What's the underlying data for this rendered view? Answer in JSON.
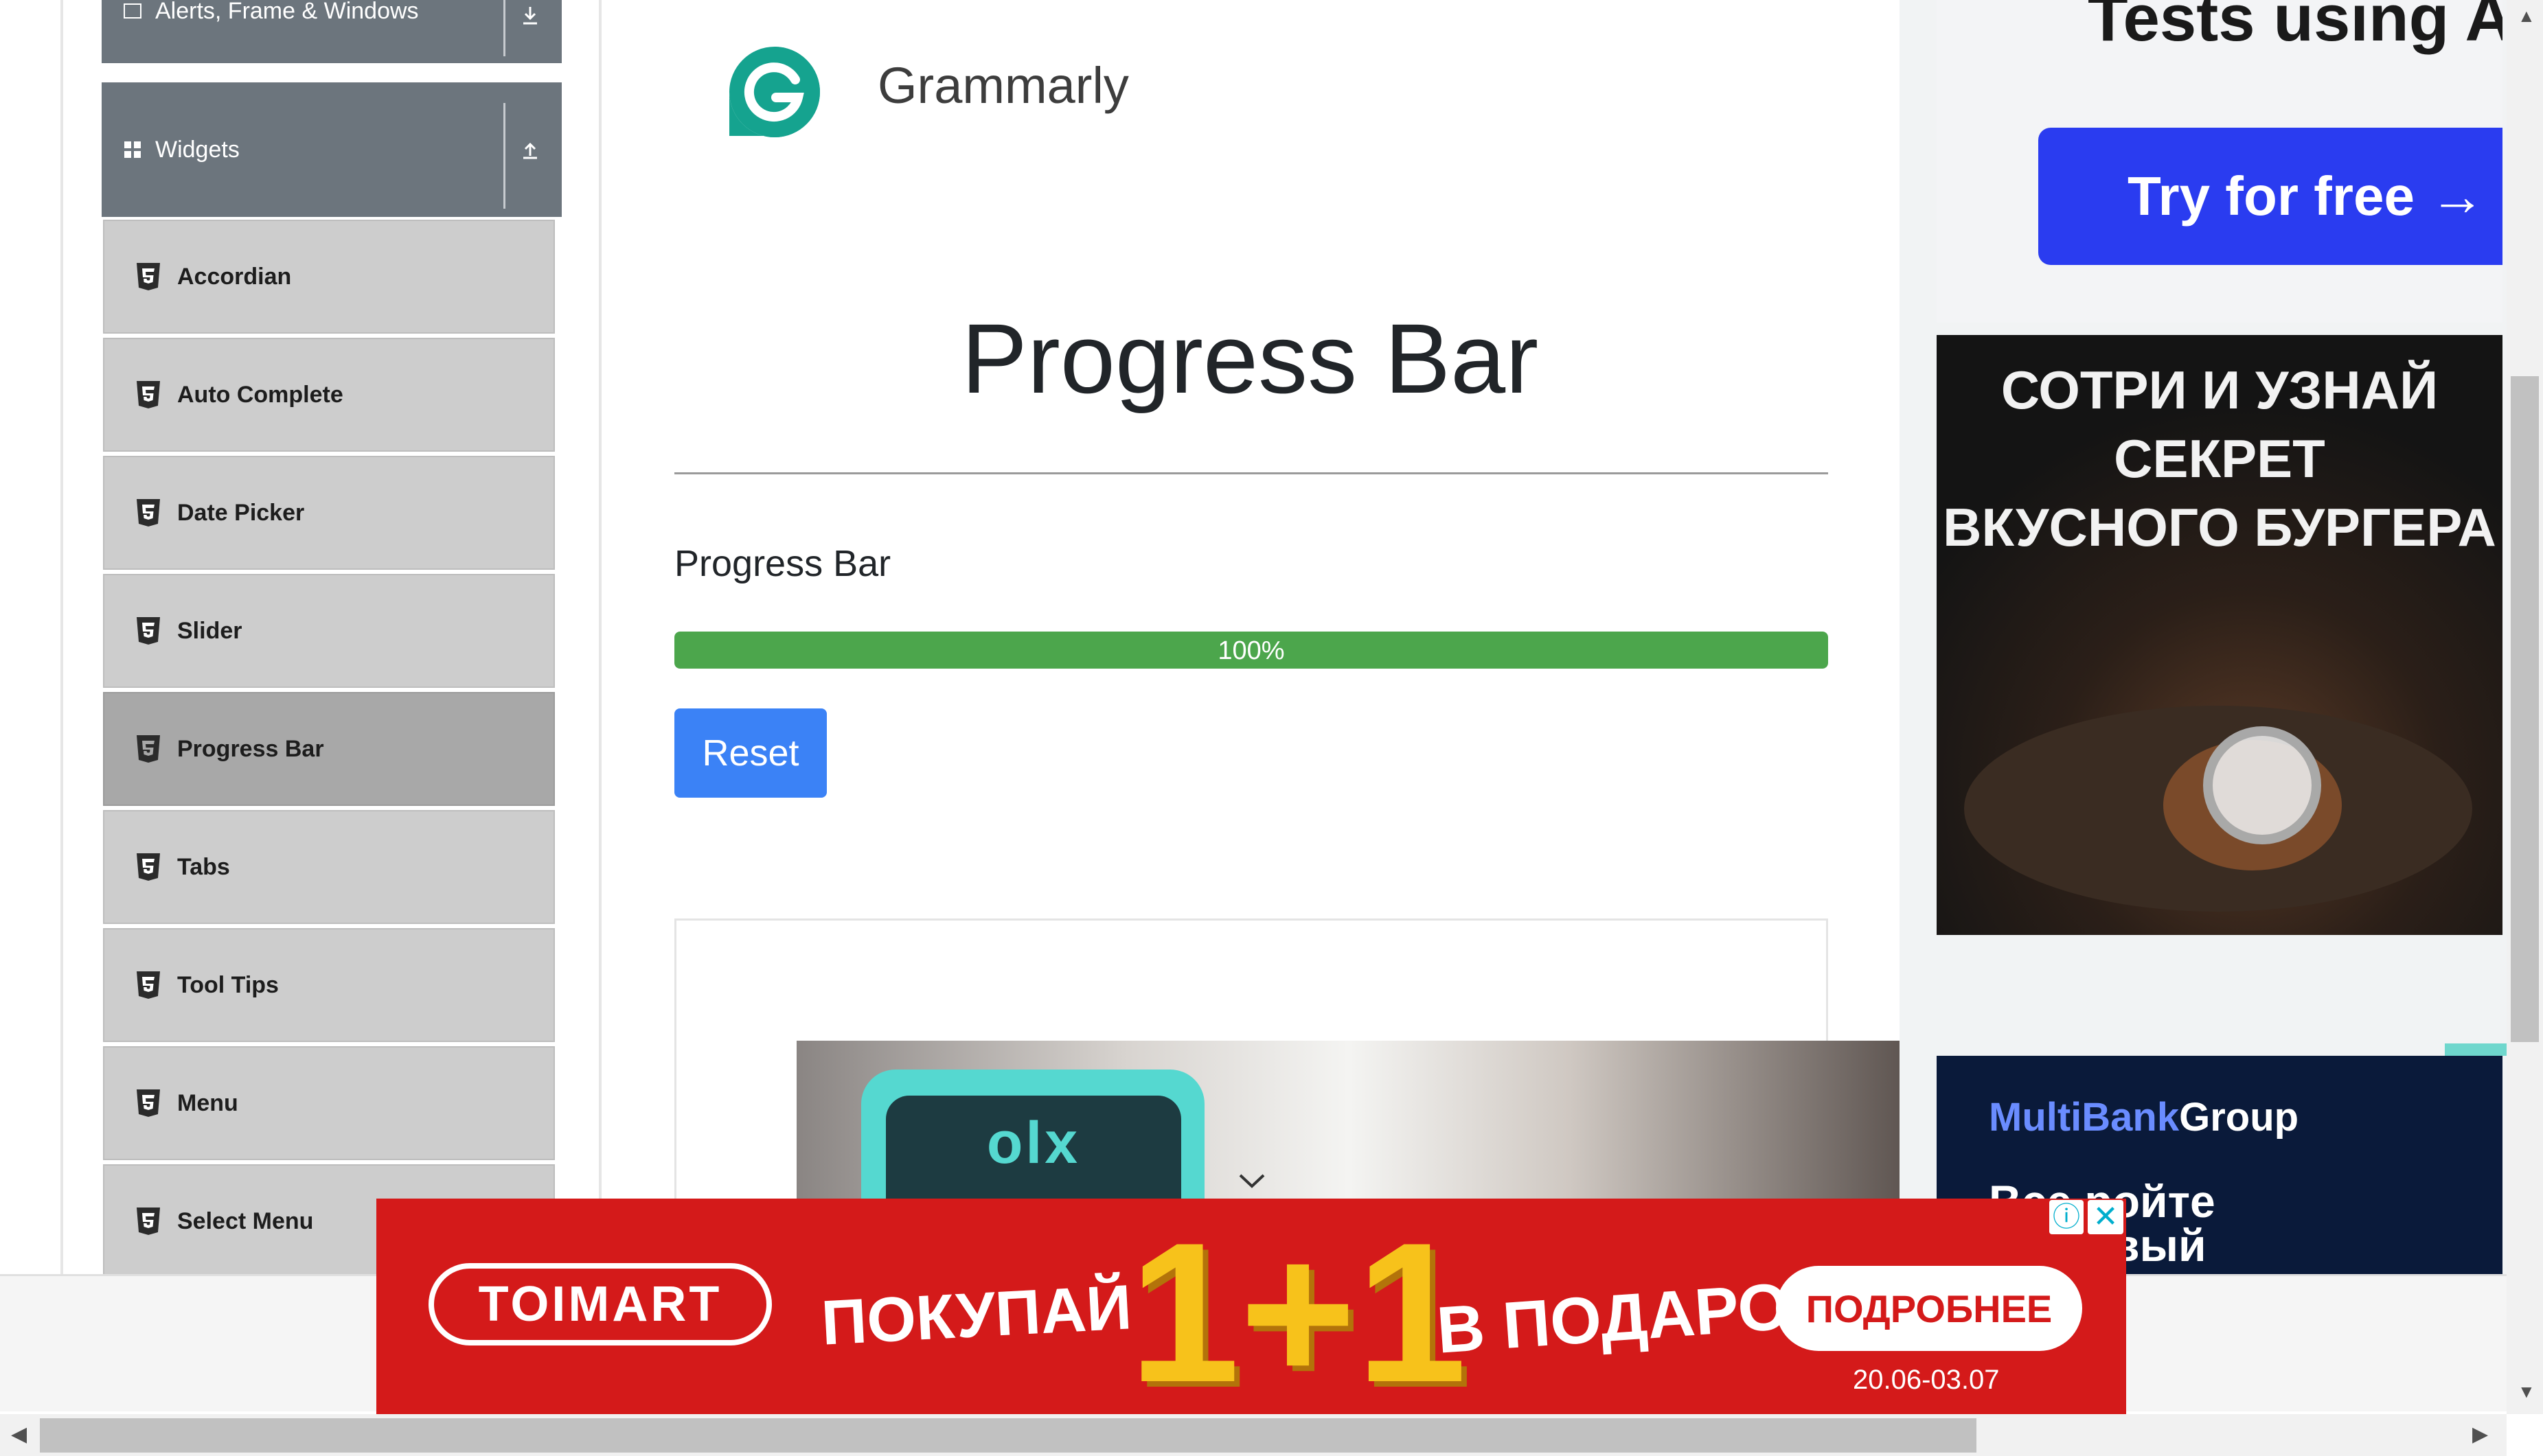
{
  "sidebar": {
    "collapsed_group": {
      "label": "Alerts, Frame & Windows"
    },
    "active_group": {
      "label": "Widgets"
    },
    "items": [
      {
        "label": "Accordian"
      },
      {
        "label": "Auto Complete"
      },
      {
        "label": "Date Picker"
      },
      {
        "label": "Slider"
      },
      {
        "label": "Progress Bar",
        "active": true
      },
      {
        "label": "Tabs"
      },
      {
        "label": "Tool Tips"
      },
      {
        "label": "Menu"
      },
      {
        "label": "Select Menu"
      }
    ]
  },
  "header": {
    "brand_name": "Grammarly"
  },
  "main": {
    "title": "Progress Bar",
    "section_label": "Progress Bar",
    "progress": {
      "value": 100,
      "label": "100%"
    },
    "reset_label": "Reset",
    "ad_logo_text": "olx"
  },
  "ads": {
    "top": {
      "title": "Tests using AI",
      "cta": "Try for free →",
      "cta_color": "#2a3cf0"
    },
    "burger": {
      "line1": "СОТРИ И УЗНАЙ СЕКРЕТ",
      "line2": "ВКУСНОГО БУРГЕРА"
    },
    "multibank": {
      "brand_a": "MultiBank",
      "brand_b": "Group",
      "line1": "Все ройте",
      "line2": "торговый"
    },
    "banner": {
      "brand": "TOIMART",
      "buy": "ПОКУПАЙ",
      "big": "1+1",
      "gift": "В ПОДАРОК",
      "cta": "ПОДРОБНЕЕ",
      "dates": "20.06-03.07",
      "color": "#d41a1a",
      "info_icon": "info-icon",
      "close_icon": "close-icon"
    }
  },
  "colors": {
    "sidebar_header": "#6c757d",
    "progress_fill": "#4ca64c",
    "reset_button": "#3b82f6"
  }
}
